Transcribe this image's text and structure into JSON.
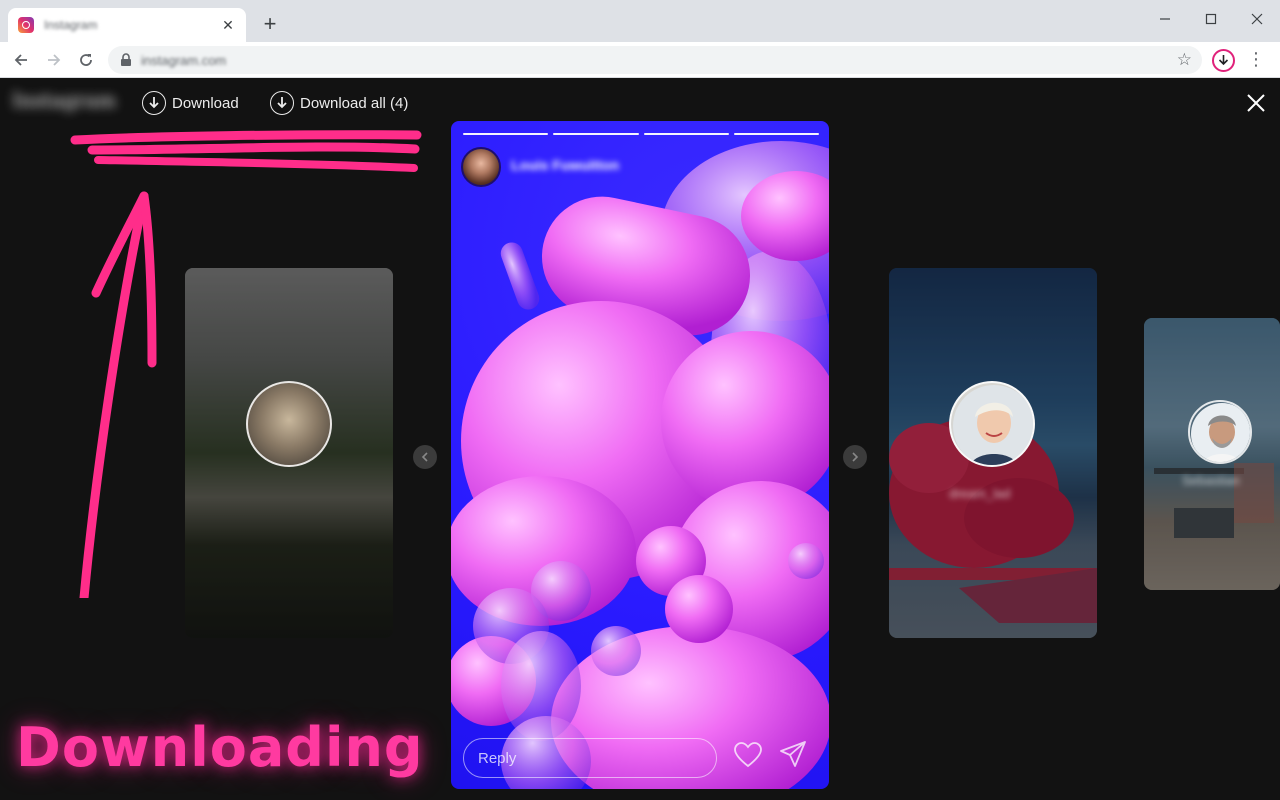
{
  "browser": {
    "tab_title": "Instagram",
    "url": "instagram.com",
    "new_tab_symbol": "+",
    "tab_close_symbol": "✕",
    "icons": [
      "back-icon",
      "forward-icon",
      "reload-icon",
      "lock-icon",
      "star-icon",
      "download-extension-icon",
      "menu-icon",
      "minimize-icon",
      "maximize-icon",
      "close-window-icon"
    ],
    "accent_color": "#e0217a"
  },
  "page": {
    "logo": "Instagram",
    "download_label": "Download",
    "download_all_label": "Download all (4)",
    "close_symbol": "✕"
  },
  "stories": {
    "current": {
      "author": "Louis Fuwuitton",
      "segments": 4,
      "reply_placeholder": "Reply"
    },
    "right_1_name": "dream_lad",
    "right_2_name": "Sebastian"
  },
  "annotation": {
    "text": "Downloading",
    "color": "#ff2d8a"
  }
}
